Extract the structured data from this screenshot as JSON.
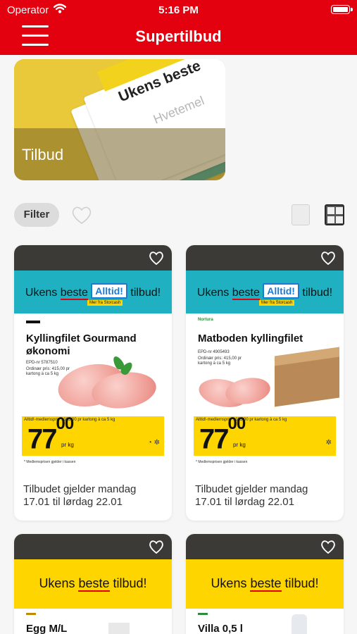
{
  "status_bar": {
    "carrier": "Operator",
    "time": "5:16 PM"
  },
  "nav": {
    "title": "Supertilbud"
  },
  "hero": {
    "label": "Tilbud",
    "paper_text": "Ukens beste",
    "paper_subtext": "Hvetemel"
  },
  "filter": {
    "label": "Filter"
  },
  "cards": [
    {
      "banner_prefix": "Ukens ",
      "banner_underlined": "beste",
      "banner_boxed": "Alltid!",
      "banner_tagline": "Mer fra Storcash",
      "banner_suffix": " tilbud!",
      "product_name": "Kyllingfilet Gourmand økonomi",
      "epd": "EPD-nr 5787510",
      "ordinary_price": "Ordinær pris: 415,00 pr kartong à ca 5 kg",
      "member_note": "Alltid!-medlemspris*: 385,00 pr kartong à ca 5 kg",
      "price_main": "77",
      "price_cents": "00",
      "price_unit": "pr kg",
      "fine_print": "* Medlemsprisen gjelder i kassen",
      "validity": "Tilbudet gjelder mandag 17.01 til lørdag 22.01"
    },
    {
      "brand": "Nortura",
      "banner_prefix": "Ukens ",
      "banner_underlined": "beste",
      "banner_boxed": "Alltid!",
      "banner_tagline": "Mer fra Storcash",
      "banner_suffix": " tilbud!",
      "product_name": "Matboden kyllingfilet",
      "epd": "EPD-nr 4905493",
      "ordinary_price": "Ordinær pris: 415,00 pr kartong à ca 5 kg",
      "member_note": "Alltid!-medlemspris*: 385,00 pr kartong à ca 5 kg",
      "price_main": "77",
      "price_cents": "00",
      "price_unit": "pr kg",
      "fine_print": "* Medlemsprisen gjelder i kassen",
      "validity": "Tilbudet gjelder mandag 17.01 til lørdag 22.01"
    },
    {
      "banner_prefix": "Ukens ",
      "banner_underlined": "beste",
      "banner_suffix": " tilbud!",
      "product_name": "Egg M/L"
    },
    {
      "banner_prefix": "Ukens ",
      "banner_underlined": "beste",
      "banner_suffix": " tilbud!",
      "product_name": "Villa 0,5 l"
    }
  ],
  "colors": {
    "brand_red": "#e3000f",
    "teal": "#1fb1c1",
    "yellow": "#ffd500",
    "card_cap": "#3b3a36"
  },
  "icons": [
    "wifi-icon",
    "battery-icon",
    "hamburger-menu-icon",
    "heart-icon",
    "single-view-icon",
    "grid-view-icon"
  ]
}
